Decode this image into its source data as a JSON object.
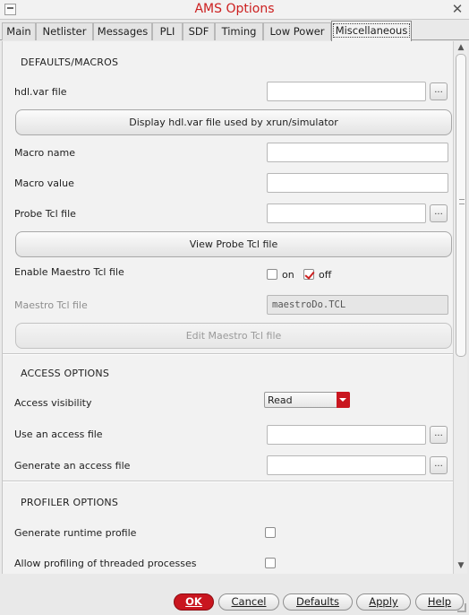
{
  "window": {
    "title": "AMS Options"
  },
  "tabs": [
    {
      "label": "Main"
    },
    {
      "label": "Netlister"
    },
    {
      "label": "Messages"
    },
    {
      "label": "PLI"
    },
    {
      "label": "SDF"
    },
    {
      "label": "Timing"
    },
    {
      "label": "Low Power"
    },
    {
      "label": "Miscellaneous",
      "active": true
    }
  ],
  "defaults": {
    "heading": "DEFAULTS/MACROS",
    "hdlvar_label": "hdl.var file",
    "hdlvar_value": "",
    "browse": "...",
    "display_hdlvar_button": "Display hdl.var file used by xrun/simulator",
    "macro_name_label": "Macro name",
    "macro_name_value": "",
    "macro_value_label": "Macro value",
    "macro_value_value": "",
    "probe_label": "Probe Tcl file",
    "probe_value": "",
    "view_probe_button": "View Probe Tcl file",
    "enable_maestro_label": "Enable Maestro Tcl file",
    "on_label": "on",
    "off_label": "off",
    "maestro_on": false,
    "maestro_off": true,
    "maestro_file_label": "Maestro Tcl file",
    "maestro_file_value": "maestroDo.TCL",
    "edit_maestro_button": "Edit Maestro Tcl file"
  },
  "access": {
    "heading": "ACCESS OPTIONS",
    "visibility_label": "Access visibility",
    "visibility_value": "Read",
    "use_file_label": "Use an access file",
    "use_file_value": "",
    "generate_file_label": "Generate an access file",
    "generate_file_value": ""
  },
  "profiler": {
    "heading": "PROFILER OPTIONS",
    "runtime_label": "Generate runtime profile",
    "runtime_checked": false,
    "threaded_label": "Allow profiling of threaded processes",
    "threaded_checked": false
  },
  "footer": {
    "ok": "OK",
    "cancel": "Cancel",
    "defaults": "Defaults",
    "apply": "Apply",
    "help": "Help"
  },
  "colors": {
    "accent": "#c9161f",
    "title": "#cc1f1f"
  }
}
